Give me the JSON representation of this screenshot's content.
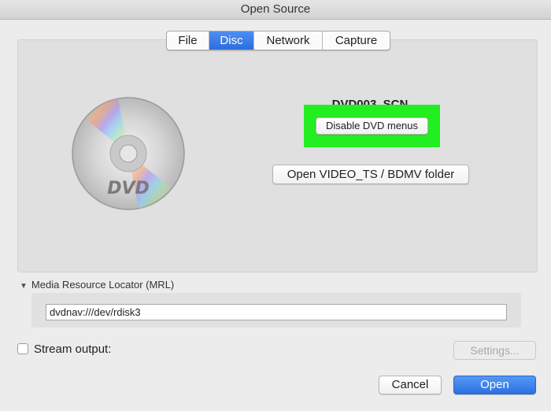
{
  "window": {
    "title": "Open Source"
  },
  "tabs": [
    {
      "label": "File",
      "active": false
    },
    {
      "label": "Disc",
      "active": true
    },
    {
      "label": "Network",
      "active": false
    },
    {
      "label": "Capture",
      "active": false
    }
  ],
  "disc": {
    "name": "DVD003_SCN",
    "icon": "dvd-disc-icon",
    "logo_text": "DVD",
    "disable_menus_label": "Disable DVD menus",
    "open_folder_label": "Open VIDEO_TS / BDMV folder",
    "highlight_color": "#22ee22"
  },
  "mrl": {
    "section_label": "Media Resource Locator (MRL)",
    "value": "dvdnav:///dev/rdisk3"
  },
  "stream_output": {
    "label": "Stream output:",
    "checked": false,
    "settings_label": "Settings..."
  },
  "footer": {
    "cancel_label": "Cancel",
    "open_label": "Open",
    "accent_color": "#2b70e0"
  }
}
